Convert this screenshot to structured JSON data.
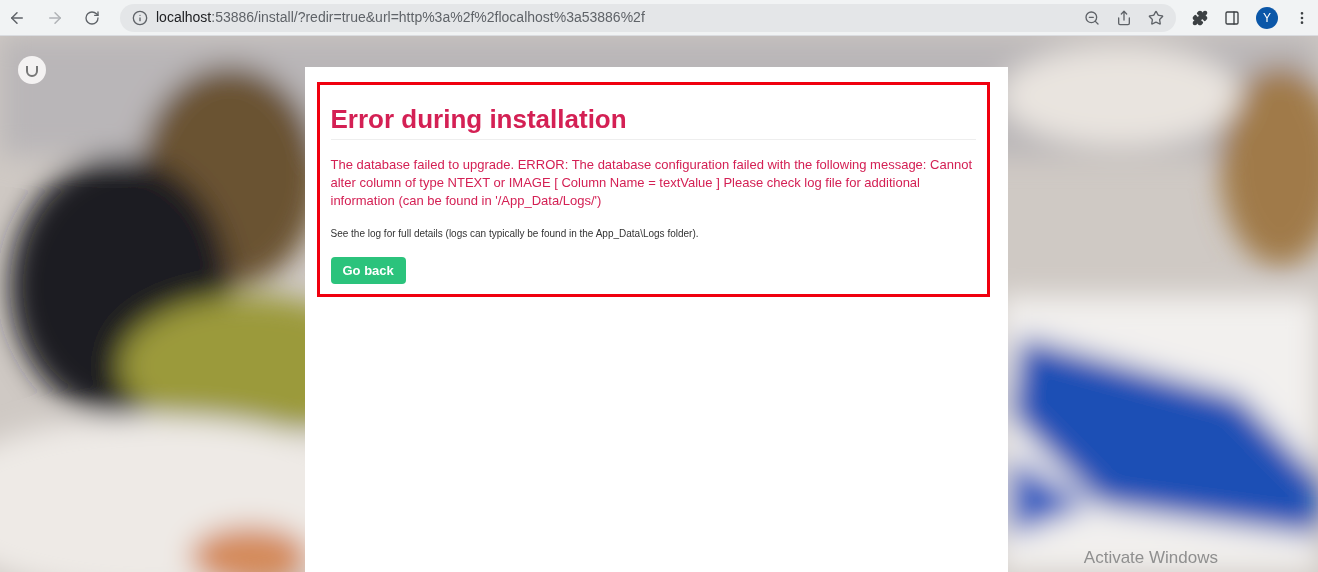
{
  "browser": {
    "url_host": "localhost",
    "url_rest": ":53886/install/?redir=true&url=http%3a%2f%2flocalhost%3a53886%2f",
    "profile_initial": "Y"
  },
  "error": {
    "title": "Error during installation",
    "message": "The database failed to upgrade. ERROR: The database configuration failed with the following message: Cannot alter column of type NTEXT or IMAGE [ Column Name = textValue ] Please check log file for additional information (can be found in '/App_Data/Logs/')",
    "hint": "See the log for full details (logs can typically be found in the App_Data\\Logs folder).",
    "button": "Go back"
  },
  "os_notice": "Activate Windows"
}
